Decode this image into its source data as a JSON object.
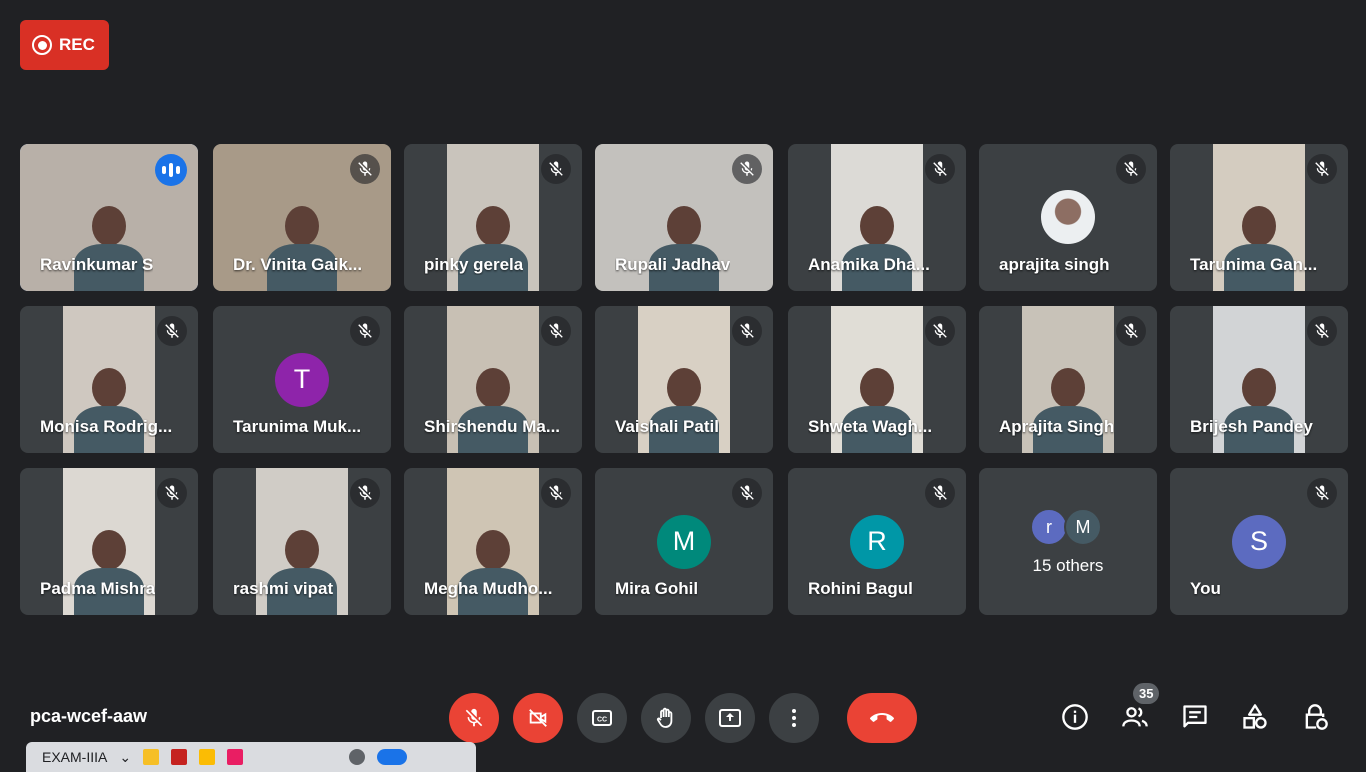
{
  "recording": {
    "label": "REC"
  },
  "participants": [
    {
      "name": "Ravinkumar S",
      "type": "video",
      "speaking": true,
      "bg": "#b8b0a8"
    },
    {
      "name": "Dr. Vinita Gaik...",
      "type": "video",
      "muted": true,
      "bg": "#a89a88"
    },
    {
      "name": "pinky gerela",
      "type": "video",
      "muted": true,
      "bg": "#c9c4bc"
    },
    {
      "name": "Rupali Jadhav",
      "type": "video",
      "muted": true,
      "bg": "#c3c1bd"
    },
    {
      "name": "Anamika Dha...",
      "type": "video",
      "muted": true,
      "bg": "#dcdad6"
    },
    {
      "name": "aprajita singh",
      "type": "photo",
      "muted": true
    },
    {
      "name": "Tarunima Gan...",
      "type": "video",
      "muted": true,
      "bg": "#d4ccc0"
    },
    {
      "name": "Monisa Rodrig...",
      "type": "video",
      "muted": true,
      "bg": "#cfc8c0"
    },
    {
      "name": "Tarunima Muk...",
      "type": "avatar",
      "muted": true,
      "initial": "T",
      "color": "#8e24aa"
    },
    {
      "name": "Shirshendu Ma...",
      "type": "video",
      "muted": true,
      "bg": "#c8c0b4"
    },
    {
      "name": "Vaishali Patil",
      "type": "video",
      "muted": true,
      "bg": "#d8d0c4"
    },
    {
      "name": "Shweta Wagh...",
      "type": "video",
      "muted": true,
      "bg": "#e0ddd6"
    },
    {
      "name": "Aprajita Singh",
      "type": "video",
      "muted": true,
      "bg": "#c8c2b8"
    },
    {
      "name": "Brijesh Pandey",
      "type": "video",
      "muted": true,
      "bg": "#d2d4d6"
    },
    {
      "name": "Padma Mishra",
      "type": "video",
      "muted": true,
      "bg": "#dcd8d2"
    },
    {
      "name": "rashmi vipat",
      "type": "video",
      "muted": true,
      "bg": "#d0ccc6"
    },
    {
      "name": "Megha Mudho...",
      "type": "video",
      "muted": true,
      "bg": "#cfc5b4"
    },
    {
      "name": "Mira Gohil",
      "type": "avatar",
      "muted": true,
      "initial": "M",
      "color": "#00897b"
    },
    {
      "name": "Rohini Bagul",
      "type": "avatar",
      "muted": true,
      "initial": "R",
      "color": "#0097a7"
    },
    {
      "name": "15 others",
      "type": "others",
      "initials": [
        "r",
        "M"
      ],
      "colors": [
        "#5c6bc0",
        "#455a64"
      ]
    },
    {
      "name": "You",
      "type": "avatar",
      "muted": true,
      "initial": "S",
      "color": "#5c6bc0"
    }
  ],
  "footer": {
    "meeting_code": "pca-wcef-aaw",
    "participant_count": "35",
    "taskbar_label": "EXAM-IIIA"
  },
  "controls": [
    {
      "name": "mic-off-button",
      "icon": "mic-off-icon",
      "red": true
    },
    {
      "name": "camera-off-button",
      "icon": "camera-off-icon",
      "red": true
    },
    {
      "name": "captions-button",
      "icon": "captions-icon"
    },
    {
      "name": "raise-hand-button",
      "icon": "hand-icon"
    },
    {
      "name": "present-button",
      "icon": "present-icon"
    },
    {
      "name": "more-options-button",
      "icon": "more-vert-icon"
    },
    {
      "name": "leave-call-button",
      "icon": "hangup-icon",
      "hangup": true
    }
  ],
  "colors": {
    "accent": "#1a73e8",
    "danger": "#ea4335",
    "tile": "#3c4043",
    "background": "#202124"
  }
}
